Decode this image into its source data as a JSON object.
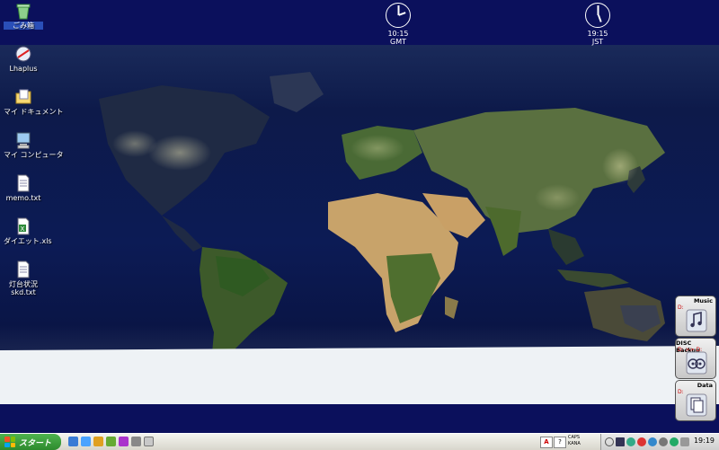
{
  "clocks": [
    {
      "time": "10:15",
      "zone": "GMT"
    },
    {
      "time": "19:15",
      "zone": "JST"
    }
  ],
  "desktop_icons": [
    {
      "label": "ごみ箱",
      "icon": "recycle-bin-icon"
    },
    {
      "label": "Lhaplus",
      "icon": "lhaplus-icon"
    },
    {
      "label": "マイ ドキュメント",
      "icon": "my-documents-icon"
    },
    {
      "label": "マイ コンピュータ",
      "icon": "my-computer-icon"
    },
    {
      "label": "memo.txt",
      "icon": "text-file-icon"
    },
    {
      "label": "ダイエット.xls",
      "icon": "excel-file-icon"
    },
    {
      "label": "灯台状況",
      "label2": "skd.txt",
      "icon": "text-file-icon"
    }
  ],
  "widgets": [
    {
      "title": "Music",
      "drive": "D:",
      "icon": "music-note-icon"
    },
    {
      "title": "DISC Backup",
      "drive": "D: >> D:",
      "icon": "disc-icon"
    },
    {
      "title": "Data",
      "drive": "D:",
      "icon": "documents-icon"
    }
  ],
  "taskbar": {
    "start_label": "スタート",
    "indicator_caps": "CAPS",
    "indicator_kana": "KANA",
    "clock": "19:19",
    "ime_a": "A",
    "ime_help": "?"
  }
}
